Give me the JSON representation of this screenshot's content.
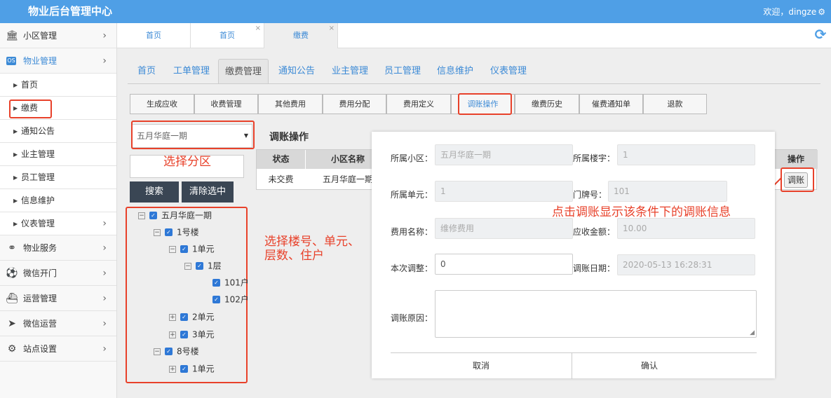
{
  "header": {
    "title": "物业后台管理中心",
    "welcome": "欢迎，dingze",
    "gear_icon": "gear-icon"
  },
  "sidebar": {
    "items": [
      {
        "label": "小区管理",
        "icon": "bank-icon"
      },
      {
        "label": "物业管理",
        "icon": "os-badge-icon"
      },
      {
        "label": "物业服务",
        "icon": "toggle-icon"
      },
      {
        "label": "微信开门",
        "icon": "ball-icon"
      },
      {
        "label": "运营管理",
        "icon": "ship-icon"
      },
      {
        "label": "微信运营",
        "icon": "send-icon"
      },
      {
        "label": "站点设置",
        "icon": "gears-icon"
      }
    ],
    "subitems": [
      "首页",
      "缴费",
      "通知公告",
      "业主管理",
      "员工管理",
      "信息维护",
      "仪表管理"
    ]
  },
  "page_tabs": [
    "首页",
    "首页",
    "缴费"
  ],
  "nav_tabs": [
    "首页",
    "工单管理",
    "缴费管理",
    "通知公告",
    "业主管理",
    "员工管理",
    "信息维护",
    "仪表管理"
  ],
  "sub_buttons": [
    "生成应收",
    "收费管理",
    "其他费用",
    "费用分配",
    "费用定义",
    "调账操作",
    "缴费历史",
    "催费通知单",
    "退款"
  ],
  "filter": {
    "select_value": "五月华庭一期",
    "search_button": "搜索",
    "clear_button": "清除选中",
    "annot_select": "选择分区",
    "annot_tree": "选择楼号、单元、层数、住户"
  },
  "tree": {
    "root": "五月华庭一期",
    "b1": "1号楼",
    "u1": "1单元",
    "f1": "1层",
    "h101": "101户",
    "h102": "102户",
    "u2": "2单元",
    "u3": "3单元",
    "b8": "8号楼",
    "b8u1": "1单元"
  },
  "table": {
    "title": "调账操作",
    "headers": {
      "status": "状态",
      "community": "小区名称",
      "action": "操作"
    },
    "row": {
      "status": "未交费",
      "community": "五月华庭一期",
      "action": "调账"
    },
    "annot": "点击调账显示该条件下的调账信息"
  },
  "modal": {
    "community_label": "所属小区：",
    "community_value": "五月华庭一期",
    "building_label": "所属楼宇：",
    "building_value": "1",
    "unit_label": "所属单元：",
    "unit_value": "1",
    "door_label": "门牌号：",
    "door_value": "101",
    "fee_label": "费用名称：",
    "fee_value": "维修费用",
    "due_label": "应收金额：",
    "due_value": "10.00",
    "adjust_label": "本次调整：",
    "adjust_value": "0",
    "date_label": "调账日期：",
    "date_value": "2020-05-13 16:28:31",
    "reason_label": "调账原因：",
    "cancel": "取消",
    "confirm": "确认"
  },
  "colors": {
    "header": "#4f9fe6",
    "accent": "#3c8ad6",
    "annotation": "#e8412a",
    "dark_button": "#3a4654"
  }
}
